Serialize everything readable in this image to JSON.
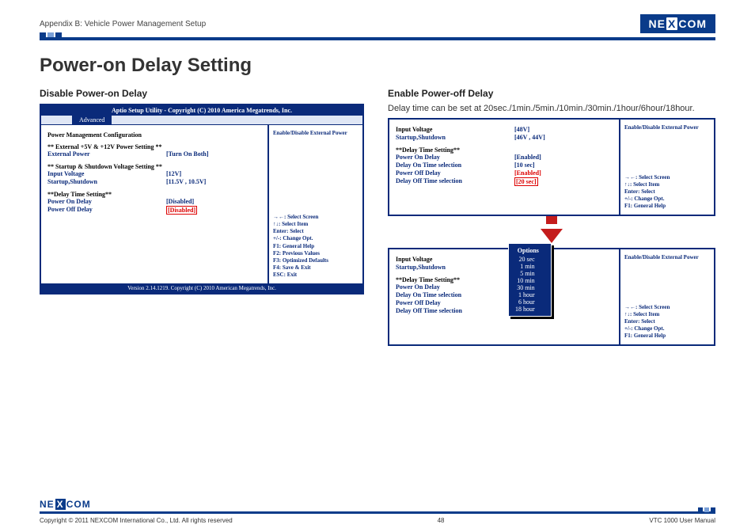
{
  "header": {
    "appendix": "Appendix B: Vehicle Power Management Setup",
    "logo_pre": "NE",
    "logo_mid": "X",
    "logo_post": "COM"
  },
  "page_title": "Power-on Delay Setting",
  "left": {
    "heading": "Disable Power-on Delay",
    "bios_title": "Aptio Setup Utility - Copyright (C) 2010 America Megatrends, Inc.",
    "tab_advanced": "Advanced",
    "section1": "Power Management Configuration",
    "ext1": "** External +5V & +12V Power Setting **",
    "ext_power_k": "External Power",
    "ext_power_v": "[Turn On Both]",
    "ssvs": "** Startup & Shutdown Voltage Setting **",
    "iv_k": "Input Voltage",
    "iv_v": "[12V]",
    "ss_k": "Startup,Shutdown",
    "ss_v": "[11.5V , 10.5V]",
    "dts": "**Delay Time Setting**",
    "pon_k": "Power On Delay",
    "pon_v": "[Disabled]",
    "poff_k": "Power Off Delay",
    "poff_v": "[Disabled]",
    "side_hint": "Enable/Disable External Power",
    "keys": [
      "→←: Select Screen",
      "↑↓: Select Item",
      "Enter: Select",
      "+/-: Change Opt.",
      "F1: General Help",
      "F2: Previous Values",
      "F3: Optimized Defaults",
      "F4: Save & Exit",
      "ESC: Exit"
    ],
    "version": "Version 2.14.1219. Copyright (C) 2010 American Megatrends, Inc."
  },
  "right": {
    "heading": "Enable Power-off Delay",
    "desc": "Delay time can be set at 20sec./1min./5min./10min./30min./1hour/6hour/18hour.",
    "p1": {
      "iv_k": "Input Voltage",
      "iv_v": "[48V]",
      "ss_k": "Startup,Shutdown",
      "ss_v": "[46V , 44V]",
      "dts": "**Delay Time Setting**",
      "pon_k": "Power On Delay",
      "pon_v": "[Enabled]",
      "donts_k": "Delay On Time selection",
      "donts_v": "[10 sec]",
      "poff_k": "Power Off Delay",
      "poff_v": "[Enabled]",
      "dofts_k": "Delay Off Time selection",
      "dofts_v": "[20 sec]",
      "side_hint": "Enable/Disable External Power",
      "keys": [
        "→←: Select Screen",
        "↑↓: Select Item",
        "Enter: Select",
        "+/-: Change Opt.",
        "F1: General Help"
      ]
    },
    "p2": {
      "iv_k": "Input Voltage",
      "ss_k": "Startup,Shutdown",
      "dts": "**Delay Time Setting**",
      "pon_k": "Power On Delay",
      "donts_k": "Delay On Time selection",
      "poff_k": "Power Off Delay",
      "dofts_k": "Delay Off Time selection",
      "opt_title": "Options",
      "options": [
        "20 sec",
        "1 min",
        "5 min",
        "10 min",
        "30 min",
        "1  hour",
        "6  hour",
        "18 hour"
      ],
      "side_hint": "Enable/Disable External Power",
      "keys": [
        "→←: Select Screen",
        "↑↓: Select Item",
        "Enter: Select",
        "+/-: Change Opt.",
        "F1: General Help"
      ]
    }
  },
  "footer": {
    "copyright": "Copyright © 2011 NEXCOM International Co., Ltd. All rights reserved",
    "page_num": "48",
    "manual": "VTC 1000 User Manual"
  }
}
